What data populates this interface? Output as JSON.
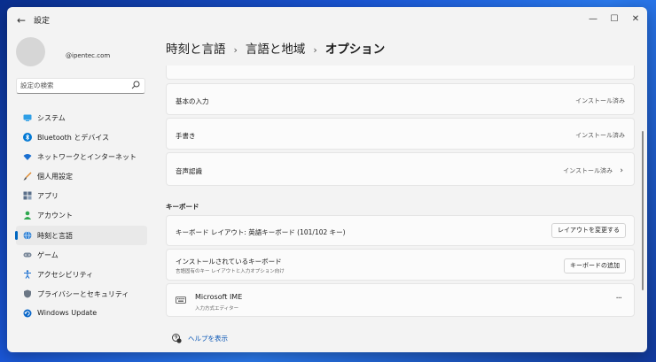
{
  "app": {
    "title": "設定"
  },
  "user": {
    "email": "@ipentec.com"
  },
  "search": {
    "placeholder": "設定の検索"
  },
  "nav": {
    "items": [
      {
        "label": "システム",
        "icon": "monitor-icon"
      },
      {
        "label": "Bluetooth とデバイス",
        "icon": "bluetooth-icon"
      },
      {
        "label": "ネットワークとインターネット",
        "icon": "wifi-icon"
      },
      {
        "label": "個人用設定",
        "icon": "brush-icon"
      },
      {
        "label": "アプリ",
        "icon": "apps-icon"
      },
      {
        "label": "アカウント",
        "icon": "person-icon"
      },
      {
        "label": "時刻と言語",
        "icon": "globe-clock-icon",
        "active": true
      },
      {
        "label": "ゲーム",
        "icon": "gamepad-icon"
      },
      {
        "label": "アクセシビリティ",
        "icon": "accessibility-icon"
      },
      {
        "label": "プライバシーとセキュリティ",
        "icon": "shield-icon"
      },
      {
        "label": "Windows Update",
        "icon": "update-icon"
      }
    ]
  },
  "breadcrumb": {
    "part1": "時刻と言語",
    "part2": "言語と地域",
    "current": "オプション"
  },
  "features": {
    "basic_input": {
      "label": "基本の入力",
      "status": "インストール済み"
    },
    "handwriting": {
      "label": "手書き",
      "status": "インストール済み"
    },
    "speech": {
      "label": "音声認識",
      "status": "インストール済み"
    }
  },
  "keyboard": {
    "section_title": "キーボード",
    "layout": {
      "label": "キーボード レイアウト: 英語キーボード (101/102 キー)",
      "button": "レイアウトを変更する"
    },
    "installed": {
      "label": "インストールされているキーボード",
      "sub": "言語固有のキー レイアウトと入力オプション向け",
      "button": "キーボードの追加"
    },
    "ime": {
      "name": "Microsoft IME",
      "sub": "入力方式エディター",
      "more": "···"
    }
  },
  "help": {
    "label": "ヘルプを表示"
  },
  "colors": {
    "accent": "#0067c0",
    "link": "#0b57b5"
  }
}
